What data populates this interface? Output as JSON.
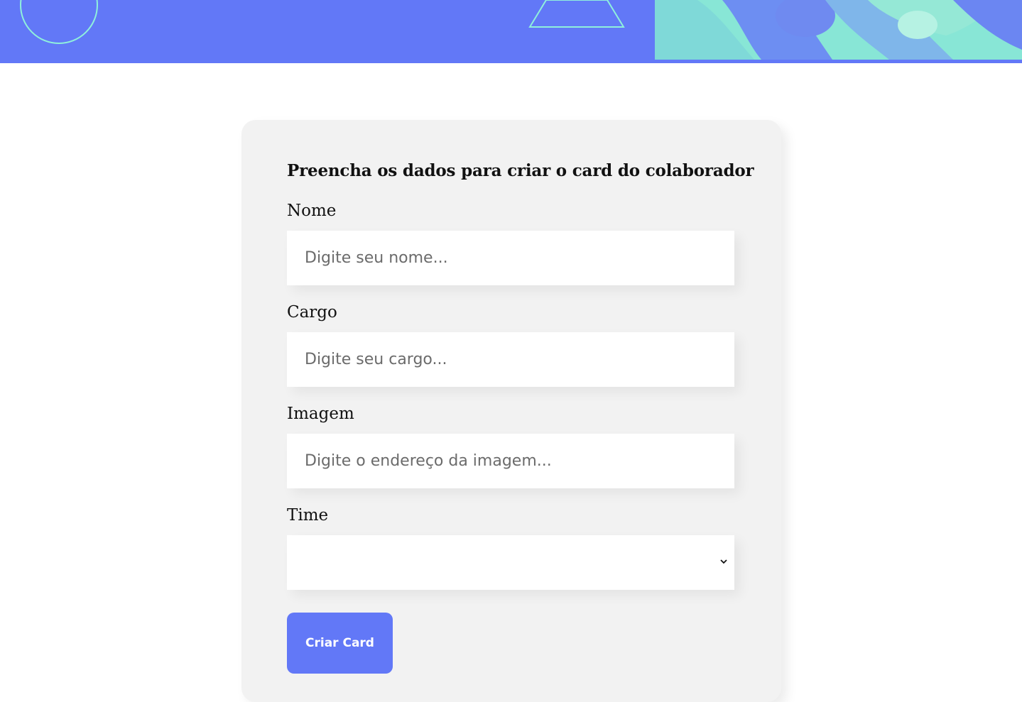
{
  "form": {
    "title": "Preencha os dados para criar o card do colaborador",
    "fields": [
      {
        "label": "Nome",
        "placeholder": "Digite seu nome..."
      },
      {
        "label": "Cargo",
        "placeholder": "Digite seu cargo..."
      },
      {
        "label": "Imagem",
        "placeholder": "Digite o endereço da imagem..."
      }
    ],
    "select": {
      "label": "Time",
      "value": ""
    },
    "submit_label": "Criar Card"
  },
  "colors": {
    "brand": "#6278f7",
    "accent": "#8ff0dc",
    "card_background": "#f2f2f2"
  }
}
